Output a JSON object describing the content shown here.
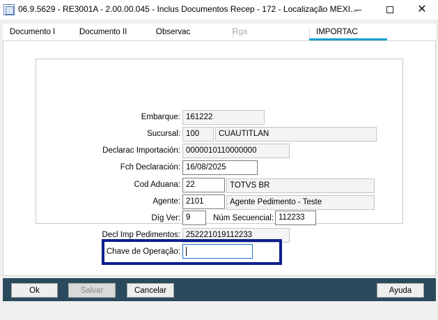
{
  "window": {
    "title": "06.9.5629 - RE3001A - 2.00.00.045 - Inclus Documentos Recep - 172 - Localização MEXI...",
    "minimize_icon": "minimize-icon",
    "maximize_icon": "maximize-icon",
    "close_icon": "close-icon"
  },
  "tabs": [
    {
      "label": "Documento  I",
      "state": "normal"
    },
    {
      "label": "Documento II",
      "state": "normal"
    },
    {
      "label": "Observac",
      "state": "normal"
    },
    {
      "label": "Rga",
      "state": "disabled"
    },
    {
      "label": "IMPORTAC",
      "state": "active"
    }
  ],
  "form": {
    "embarque": {
      "label": "Embarque:",
      "value": "161222"
    },
    "sucursal": {
      "label": "Sucursal:",
      "code": "100",
      "name": "CUAUTITLAN"
    },
    "declarac_importacion": {
      "label": "Declarac Importación:",
      "value": "0000010110000000"
    },
    "fch_declaracion": {
      "label": "Fch Declaración:",
      "value": "16/08/2025"
    },
    "cod_aduana": {
      "label": "Cod Aduana:",
      "code": "22",
      "name": "TOTVS BR"
    },
    "agente": {
      "label": "Agente:",
      "code": "2101",
      "name": "Agente Pedimento - Teste"
    },
    "dig_ver": {
      "label": "Díg Ver:",
      "value": "9"
    },
    "num_secuencial": {
      "label": "Núm Secuencial:",
      "value": "112233"
    },
    "decl_imp_pedimentos": {
      "label": "Decl Imp Pedimentos:",
      "value": "252221019112233"
    },
    "chave_operacao": {
      "label": "Chave de Operação:",
      "value": ""
    }
  },
  "colors": {
    "footer": "#2c4a5d",
    "active_tab": "#1a9ed4",
    "highlight": "#0a1f8f"
  },
  "buttons": {
    "ok": "Ok",
    "salvar": "Salvar",
    "cancelar": "Cancelar",
    "ayuda": "Ayuda"
  }
}
